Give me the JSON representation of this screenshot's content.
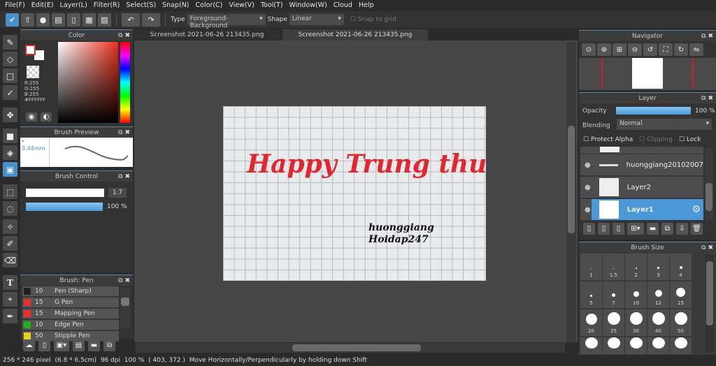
{
  "menu": [
    "File(F)",
    "Edit(E)",
    "Layer(L)",
    "Filter(R)",
    "Select(S)",
    "Snap(N)",
    "Color(C)",
    "View(V)",
    "Tool(T)",
    "Window(W)",
    "Cloud",
    "Help"
  ],
  "toolbar": {
    "type_label": "Type",
    "type_value": "Foreground-Background",
    "shape_label": "Shape",
    "shape_value": "Linear",
    "snap_label": "Snap to grid"
  },
  "tabs": [
    "Screenshot 2021-06-26 213435.png",
    "Screenshot 2021-06-26 213435.png"
  ],
  "color_panel": {
    "title": "Color",
    "r": "R:255",
    "g": "G:255",
    "b": "B:255",
    "hex": "#FFFFFF",
    "foreground": "#ffffff",
    "accent": "#d42a2a"
  },
  "brush_preview": {
    "title": "Brush Preview",
    "size": "* 0.44mm"
  },
  "brush_control": {
    "title": "Brush Control",
    "size_value": "1.7",
    "opacity_value": "100 %"
  },
  "brush_list": {
    "title": "Brush: Pen",
    "items": [
      {
        "size": "10",
        "name": "Pen (Sharp)",
        "color": "#222222"
      },
      {
        "size": "15",
        "name": "G Pen",
        "color": "#e83030"
      },
      {
        "size": "15",
        "name": "Mapping Pen",
        "color": "#e83030"
      },
      {
        "size": "10",
        "name": "Edge Pen",
        "color": "#22b022"
      },
      {
        "size": "50",
        "name": "Stipple Pen",
        "color": "#e8d020"
      }
    ]
  },
  "canvas": {
    "title_text": "Happy Trung thu",
    "signature_line1": "huonggiang",
    "signature_line2": "Hoidap247",
    "title_color": "#e0262e"
  },
  "navigator": {
    "title": "Navigator"
  },
  "layer_panel": {
    "title": "Layer",
    "opacity_label": "Opacity",
    "opacity_value": "100 %",
    "opacity": 100,
    "blending_label": "Blending",
    "blending_value": "Normal",
    "protect_alpha": "Protect Alpha",
    "clipping": "Clipping",
    "lock": "Lock",
    "layers": [
      {
        "name": "huonggiang20102007"
      },
      {
        "name": "Layer2"
      },
      {
        "name": "Layer1",
        "selected": true
      }
    ]
  },
  "brush_size": {
    "title": "Brush Size",
    "sizes": [
      "1",
      "1.5",
      "2",
      "3",
      "4",
      "5",
      "7",
      "10",
      "12",
      "15",
      "20",
      "25",
      "30",
      "40",
      "50",
      "",
      "",
      "",
      "",
      ""
    ]
  },
  "status": {
    "dimensions": "256 * 246 pixel",
    "physical": "(6.8 * 6.5cm)",
    "dpi": "96 dpi",
    "zoom": "100 %",
    "coords": "( 403, 372 )",
    "hint": "Move Horizontally/Perpendicularly by holding down Shift"
  }
}
